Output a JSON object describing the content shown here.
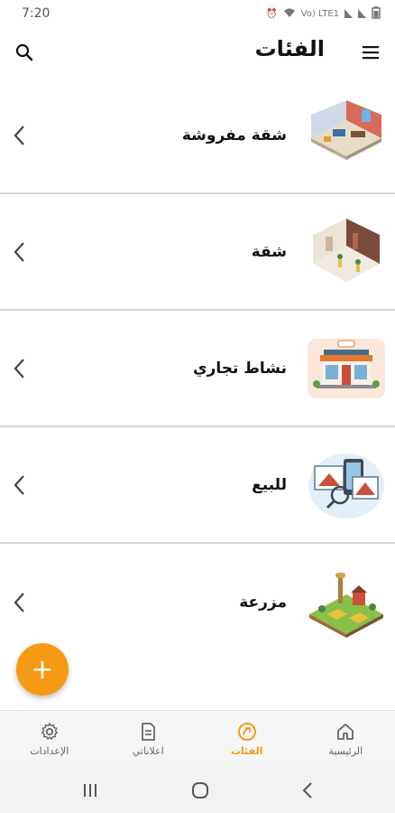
{
  "status_bar": {
    "time": "7:20",
    "network_label": "Vo) LTE1"
  },
  "app_bar": {
    "title": "الفئات"
  },
  "categories": [
    {
      "label": "شقة مفروشة",
      "icon": "furnished-apartment-illustration"
    },
    {
      "label": "شقة",
      "icon": "apartment-illustration"
    },
    {
      "label": "نشاط تجاري",
      "icon": "shop-illustration"
    },
    {
      "label": "للبيع",
      "icon": "for-sale-illustration"
    },
    {
      "label": "مزرعة",
      "icon": "farm-illustration"
    }
  ],
  "fab": {
    "label": "+"
  },
  "bottom_nav": {
    "items": [
      {
        "label": "الرئيسية",
        "icon": "home-icon",
        "active": false
      },
      {
        "label": "الفئات",
        "icon": "categories-icon",
        "active": true
      },
      {
        "label": "اعلاناتي",
        "icon": "my-ads-icon",
        "active": false
      },
      {
        "label": "الإعدادات",
        "icon": "settings-icon",
        "active": false
      }
    ]
  },
  "colors": {
    "accent": "#f59a12",
    "divider": "#d6d6d6"
  }
}
